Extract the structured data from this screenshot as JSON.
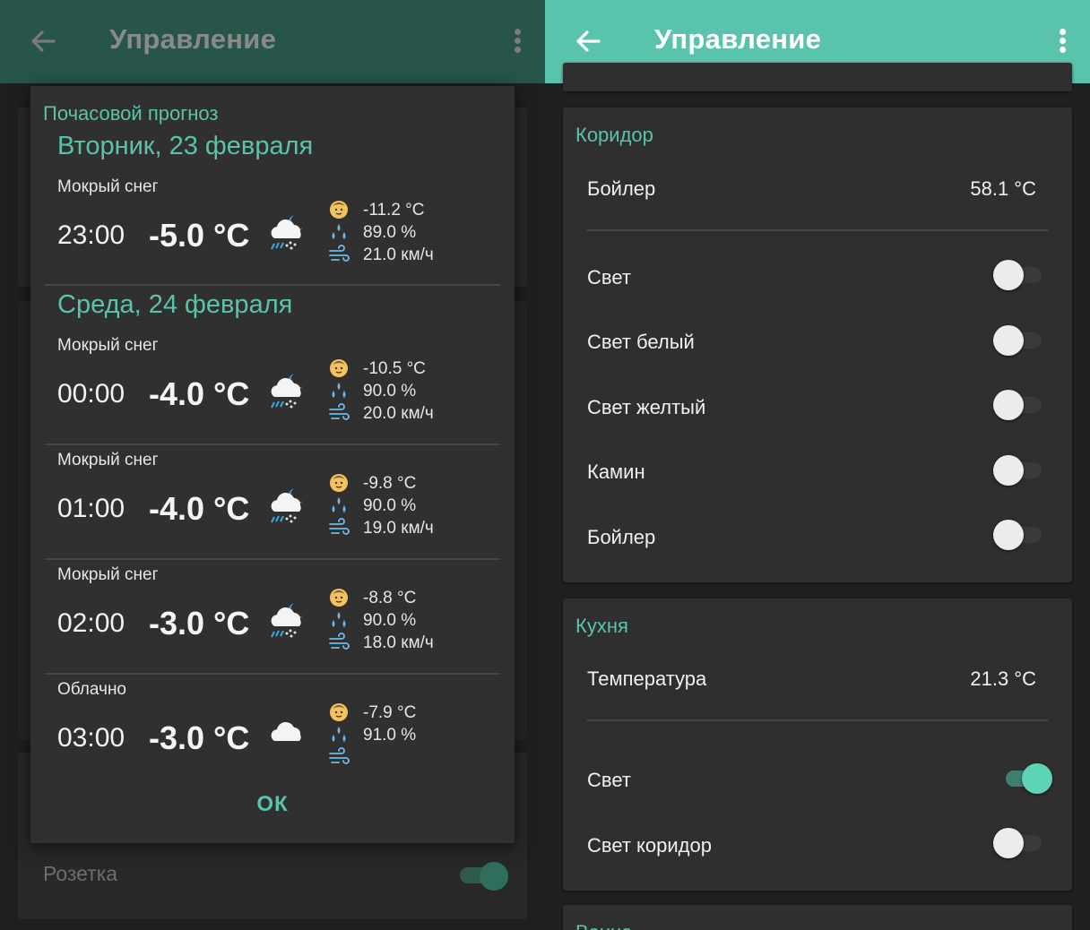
{
  "left": {
    "appbar": {
      "title": "Управление"
    },
    "background": {
      "row_label": "Розетка"
    },
    "dialog": {
      "title": "Почасовой прогноз",
      "ok_label": "ОК",
      "days": [
        {
          "heading": "Вторник, 23 февраля",
          "hours": [
            {
              "condition": "Мокрый снег",
              "time": "23:00",
              "temp": "-5.0 °C",
              "icon": "snow-cloud-sun-icon",
              "feels": "-11.2 °C",
              "humidity": "89.0 %",
              "wind": "21.0 км/ч"
            }
          ]
        },
        {
          "heading": "Среда, 24 февраля",
          "hours": [
            {
              "condition": "Мокрый снег",
              "time": "00:00",
              "temp": "-4.0 °C",
              "icon": "snow-cloud-sun-icon",
              "feels": "-10.5 °C",
              "humidity": "90.0 %",
              "wind": "20.0 км/ч"
            },
            {
              "condition": "Мокрый снег",
              "time": "01:00",
              "temp": "-4.0 °C",
              "icon": "snow-cloud-sun-icon",
              "feels": "-9.8 °C",
              "humidity": "90.0 %",
              "wind": "19.0 км/ч"
            },
            {
              "condition": "Мокрый снег",
              "time": "02:00",
              "temp": "-3.0 °C",
              "icon": "snow-cloud-sun-icon",
              "feels": "-8.8 °C",
              "humidity": "90.0 %",
              "wind": "18.0 км/ч"
            },
            {
              "condition": "Облачно",
              "time": "03:00",
              "temp": "-3.0 °C",
              "icon": "cloud-icon",
              "feels": "-7.9 °C",
              "humidity": "91.0 %",
              "wind": ""
            }
          ]
        }
      ]
    }
  },
  "right": {
    "appbar": {
      "title": "Управление"
    },
    "cards": [
      {
        "title": "Коридор",
        "sensor": {
          "label": "Бойлер",
          "value": "58.1 °C"
        },
        "switches": [
          {
            "label": "Свет",
            "on": false
          },
          {
            "label": "Свет белый",
            "on": false
          },
          {
            "label": "Свет желтый",
            "on": false
          },
          {
            "label": "Камин",
            "on": false
          },
          {
            "label": "Бойлер",
            "on": false
          }
        ]
      },
      {
        "title": "Кухня",
        "sensor": {
          "label": "Температура",
          "value": "21.3 °C"
        },
        "switches": [
          {
            "label": "Свет",
            "on": true
          },
          {
            "label": "Свет коридор",
            "on": false
          }
        ]
      },
      {
        "title": "Ванна"
      }
    ]
  },
  "colors": {
    "accent": "#5ac3ab",
    "appbar_dim": "#275549",
    "card": "#2f2f2f"
  }
}
